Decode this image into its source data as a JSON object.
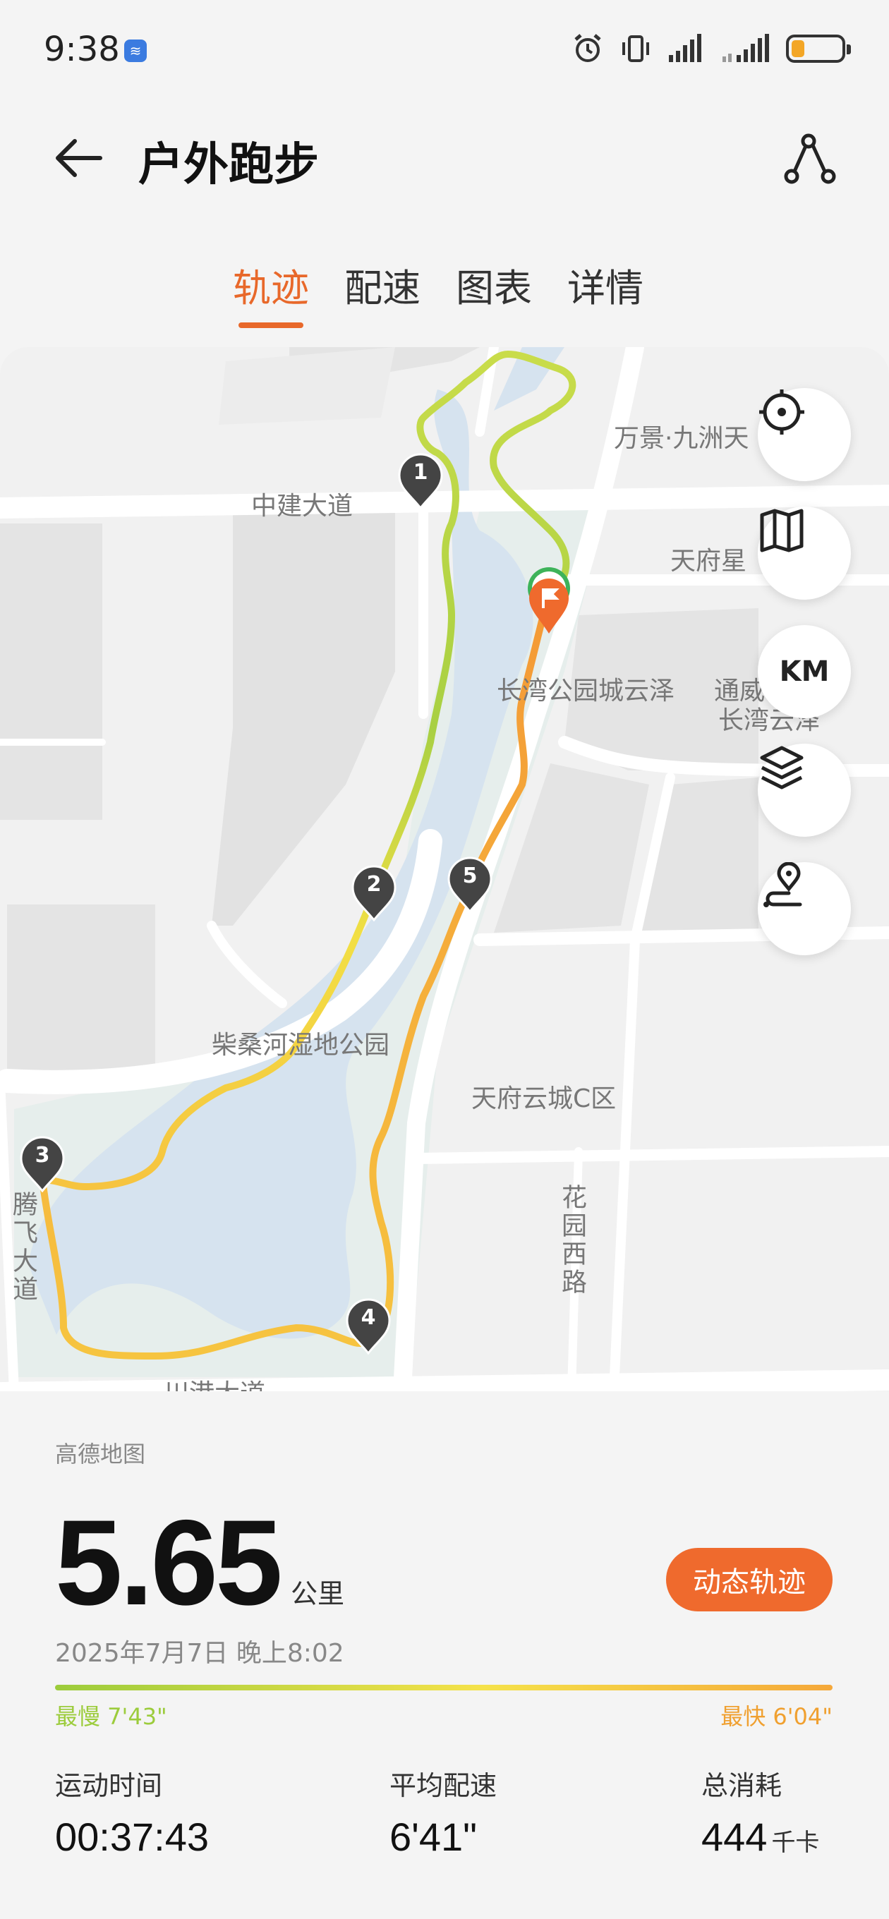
{
  "status_bar": {
    "time": "9:38"
  },
  "header": {
    "title": "户外跑步"
  },
  "tabs": [
    {
      "label": "轨迹",
      "active": true
    },
    {
      "label": "配速",
      "active": false
    },
    {
      "label": "图表",
      "active": false
    },
    {
      "label": "详情",
      "active": false
    }
  ],
  "map": {
    "labels": {
      "wanjing": "万景·九洲天",
      "zhongjian": "中建大道",
      "tianfu_star": "天府星",
      "changwan": "长湾公园城云泽",
      "tongwei": "通威",
      "changwan2": "长湾云泽",
      "chaisang": "柴桑河湿地公园",
      "tianfu_c": "天府云城C区",
      "huayuan": "花园西路",
      "tengfei": "腾飞大道",
      "chuangang": "川港大道"
    },
    "controls": {
      "units_label": "KM"
    },
    "markers": [
      "1",
      "2",
      "3",
      "4",
      "5"
    ],
    "source": "高德地图"
  },
  "summary": {
    "distance": "5.65",
    "distance_unit": "公里",
    "dynamic_track_label": "动态轨迹",
    "datetime": "2025年7月7日 晚上8:02",
    "slowest": "最慢 7'43\"",
    "fastest": "最快 6'04\""
  },
  "stats": {
    "duration_label": "运动时间",
    "duration_value": "00:37:43",
    "pace_label": "平均配速",
    "pace_value": "6'41\"",
    "calories_label": "总消耗",
    "calories_value": "444",
    "calories_unit": "千卡"
  },
  "colors": {
    "accent": "#e8682a",
    "track_slow": "#9ccc3c",
    "track_mid": "#f5e24a",
    "track_fast": "#f5a83a"
  }
}
